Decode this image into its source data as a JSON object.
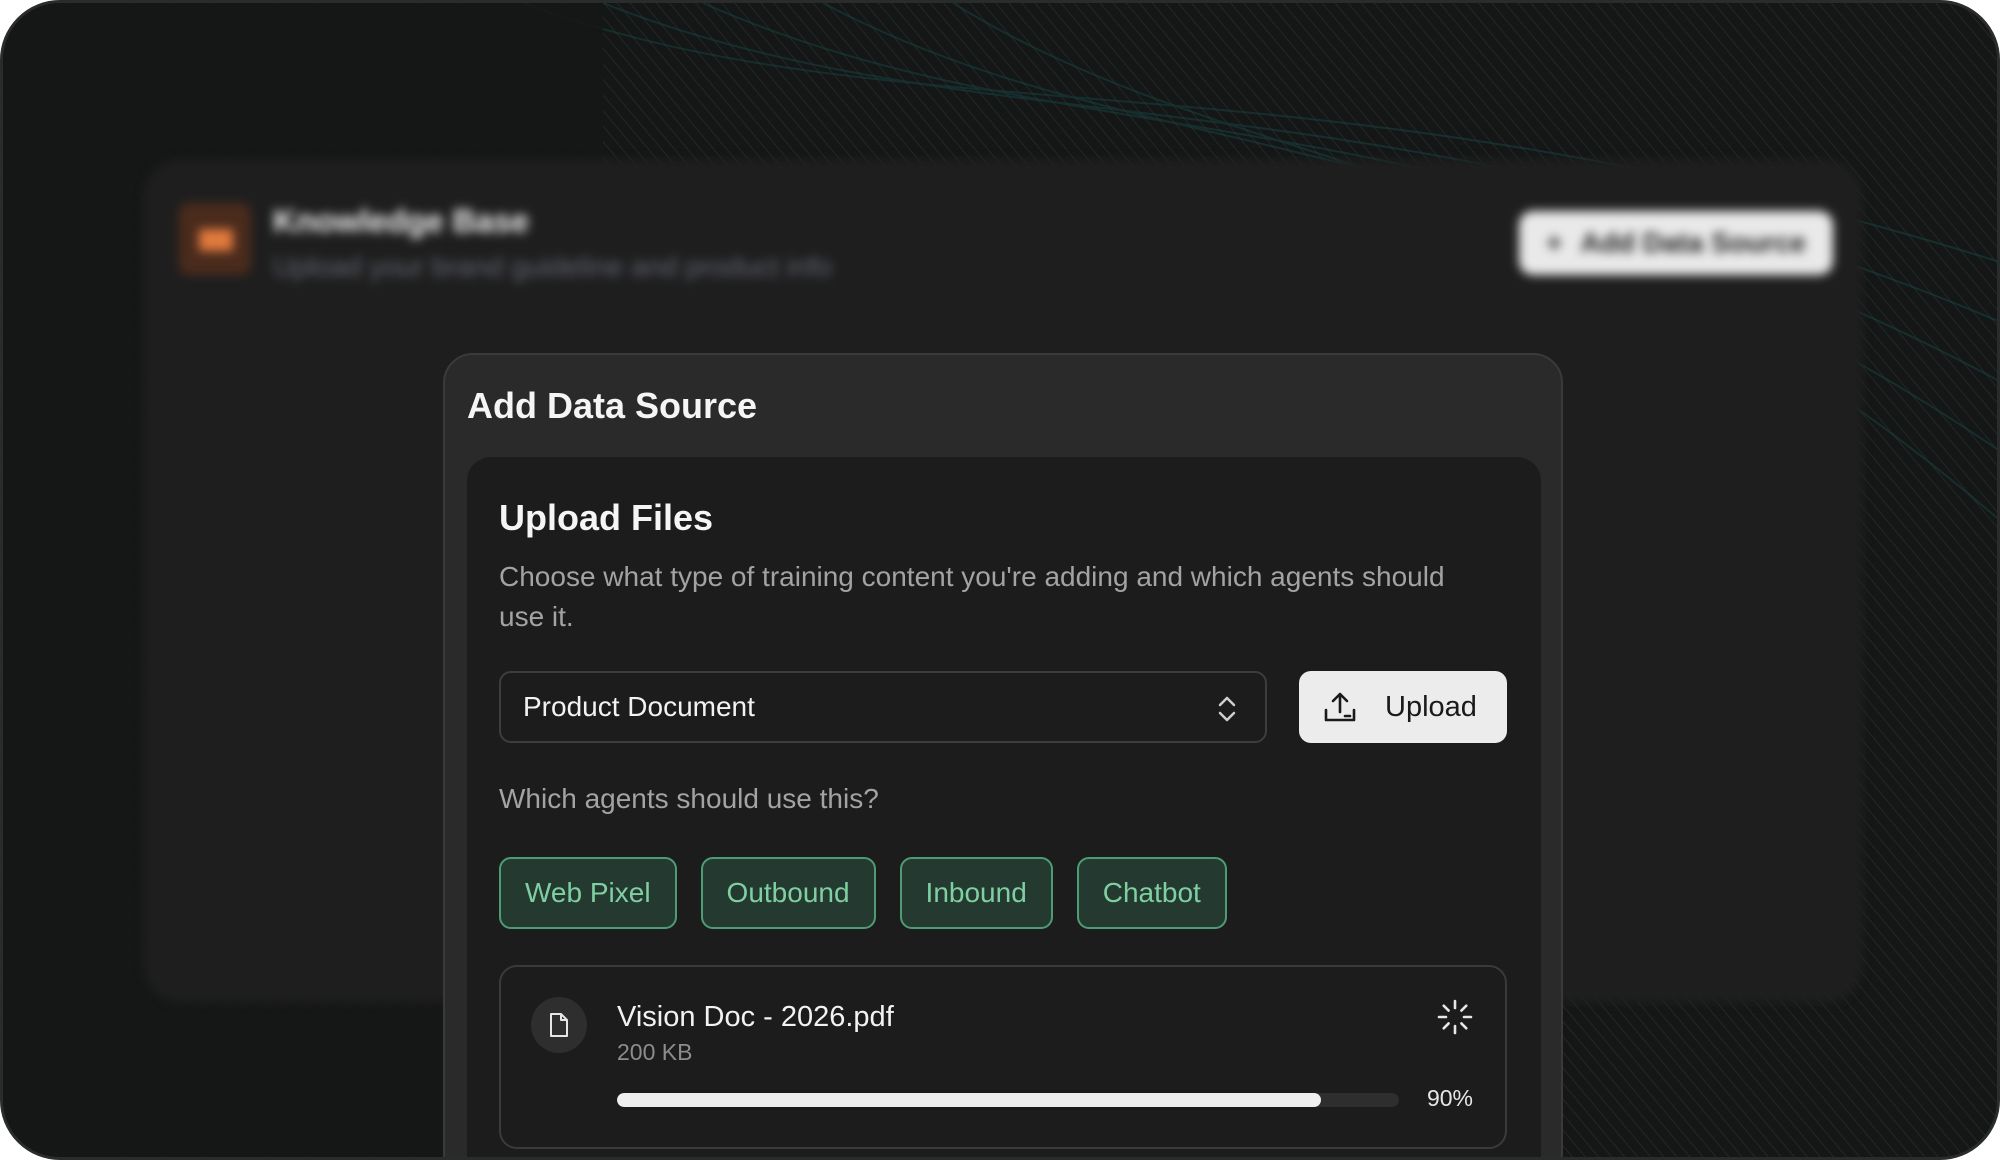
{
  "background_card": {
    "title": "Knowledge Base",
    "subtitle": "Upload your brand guideline and product info",
    "add_button_label": "Add Data Source",
    "icon": "book-icon"
  },
  "dialog": {
    "title": "Add Data Source",
    "panel": {
      "title": "Upload Files",
      "description": "Choose what type of training content you're adding and which agents should use it.",
      "content_type_select": {
        "value": "Product Document",
        "icon": "chevron-updown-icon"
      },
      "upload_button": {
        "label": "Upload",
        "icon": "upload-icon"
      },
      "agents_label": "Which agents should use this?",
      "agents": [
        {
          "label": "Web Pixel",
          "selected": true
        },
        {
          "label": "Outbound",
          "selected": true
        },
        {
          "label": "Inbound",
          "selected": true
        },
        {
          "label": "Chatbot",
          "selected": true
        }
      ],
      "file": {
        "name": "Vision Doc - 2026.pdf",
        "size": "200 KB",
        "progress_percent": 90,
        "progress_label": "90%",
        "icon": "document-icon",
        "status_icon": "loading-spinner-icon"
      }
    }
  },
  "colors": {
    "chip_border": "#4e9c76",
    "chip_text": "#7fcfa3",
    "accent_orange": "#e07a3c"
  }
}
